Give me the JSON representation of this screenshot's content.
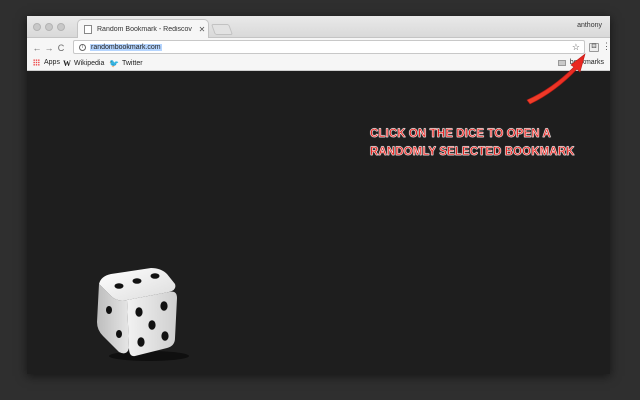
{
  "tab": {
    "title": "Random Bookmark - Rediscov",
    "close_label": "✕"
  },
  "profile": {
    "name": "anthony"
  },
  "toolbar": {
    "back": "←",
    "forward": "→",
    "reload": "C",
    "url": "randombookmark.com",
    "info_glyph": "i",
    "star": "☆",
    "extension_glyph": "⚃",
    "menu": "⋮"
  },
  "bookmarks_bar": {
    "items": [
      {
        "label": "Apps",
        "icon": "apps-icon"
      },
      {
        "label": "Wikipedia",
        "icon": "wikipedia-icon",
        "glyph": "W"
      },
      {
        "label": "Twitter",
        "icon": "twitter-icon",
        "glyph": "🐦"
      }
    ],
    "other": {
      "label": "bookmarks",
      "icon": "folder-icon"
    }
  },
  "annotation": {
    "line1": "CLICK ON THE DICE TO OPEN A",
    "line2": "RANDOMLY SELECTED BOOKMARK",
    "color": "#e8231f"
  },
  "dice": {
    "icon": "dice-icon",
    "top_face": 3,
    "front_face": 5
  }
}
